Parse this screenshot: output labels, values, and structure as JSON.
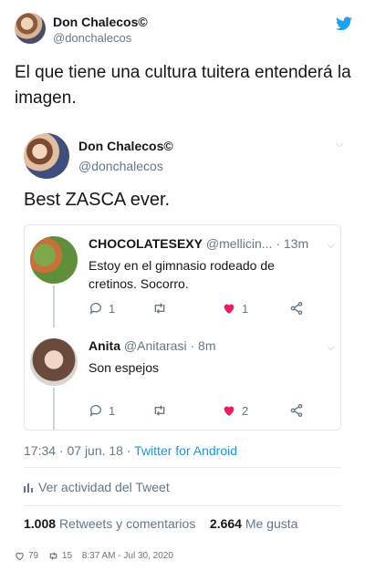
{
  "outer": {
    "name": "Don Chalecos©",
    "handle": "@donchalecos",
    "text": "El que tiene una cultura tuitera entenderá la imagen."
  },
  "embed": {
    "name": "Don Chalecos©",
    "handle": "@donchalecos",
    "text": "Best ZASCA ever.",
    "replies": [
      {
        "name": "CHOCOLATESEXY",
        "handle": "@mellicin...",
        "dot": "·",
        "time": "13m",
        "text": "Estoy en el gimnasio rodeado de cretinos. Socorro.",
        "reply_count": "1",
        "retweet_count": "",
        "like_count": "1"
      },
      {
        "name": "Anita",
        "handle": "@Anitarasi",
        "dot": "·",
        "time": "8m",
        "text": "Son espejos",
        "reply_count": "1",
        "retweet_count": "",
        "like_count": "2"
      }
    ],
    "meta_time": "17:34 · 07 jun. 18 · ",
    "meta_source": "Twitter for Android",
    "activity_label": "Ver actividad del Tweet",
    "retweets_count": "1.008",
    "retweets_label": "Retweets y comentarios",
    "likes_count": "2.664",
    "likes_label": "Me gusta"
  },
  "footer": {
    "likes": "79",
    "retweets": "15",
    "timestamp": "8:37 AM - Jul 30, 2020"
  },
  "colors": {
    "accent": "#1b95e0",
    "like": "#e0245e",
    "muted": "#657786"
  }
}
